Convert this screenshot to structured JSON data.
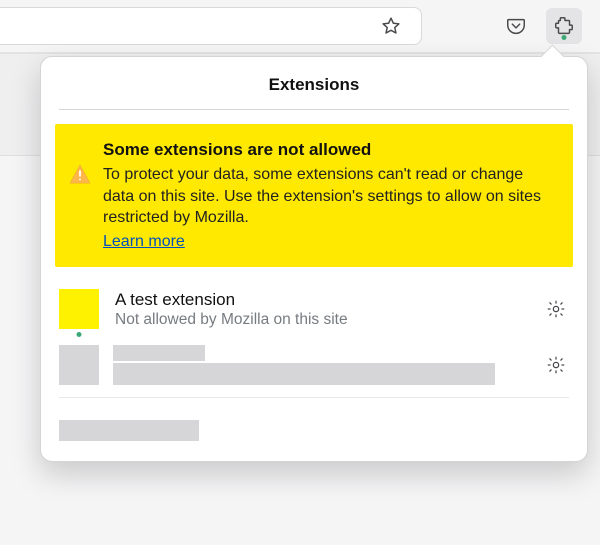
{
  "panel": {
    "title": "Extensions"
  },
  "warning": {
    "heading": "Some extensions are not allowed",
    "text": "To protect your data, some extensions can't read or change data on this site. Use the extension's settings to allow on sites restricted by Mozilla.",
    "learn_more": "Learn more"
  },
  "extension": {
    "name": "A test extension",
    "status": "Not allowed by Mozilla on this site"
  }
}
